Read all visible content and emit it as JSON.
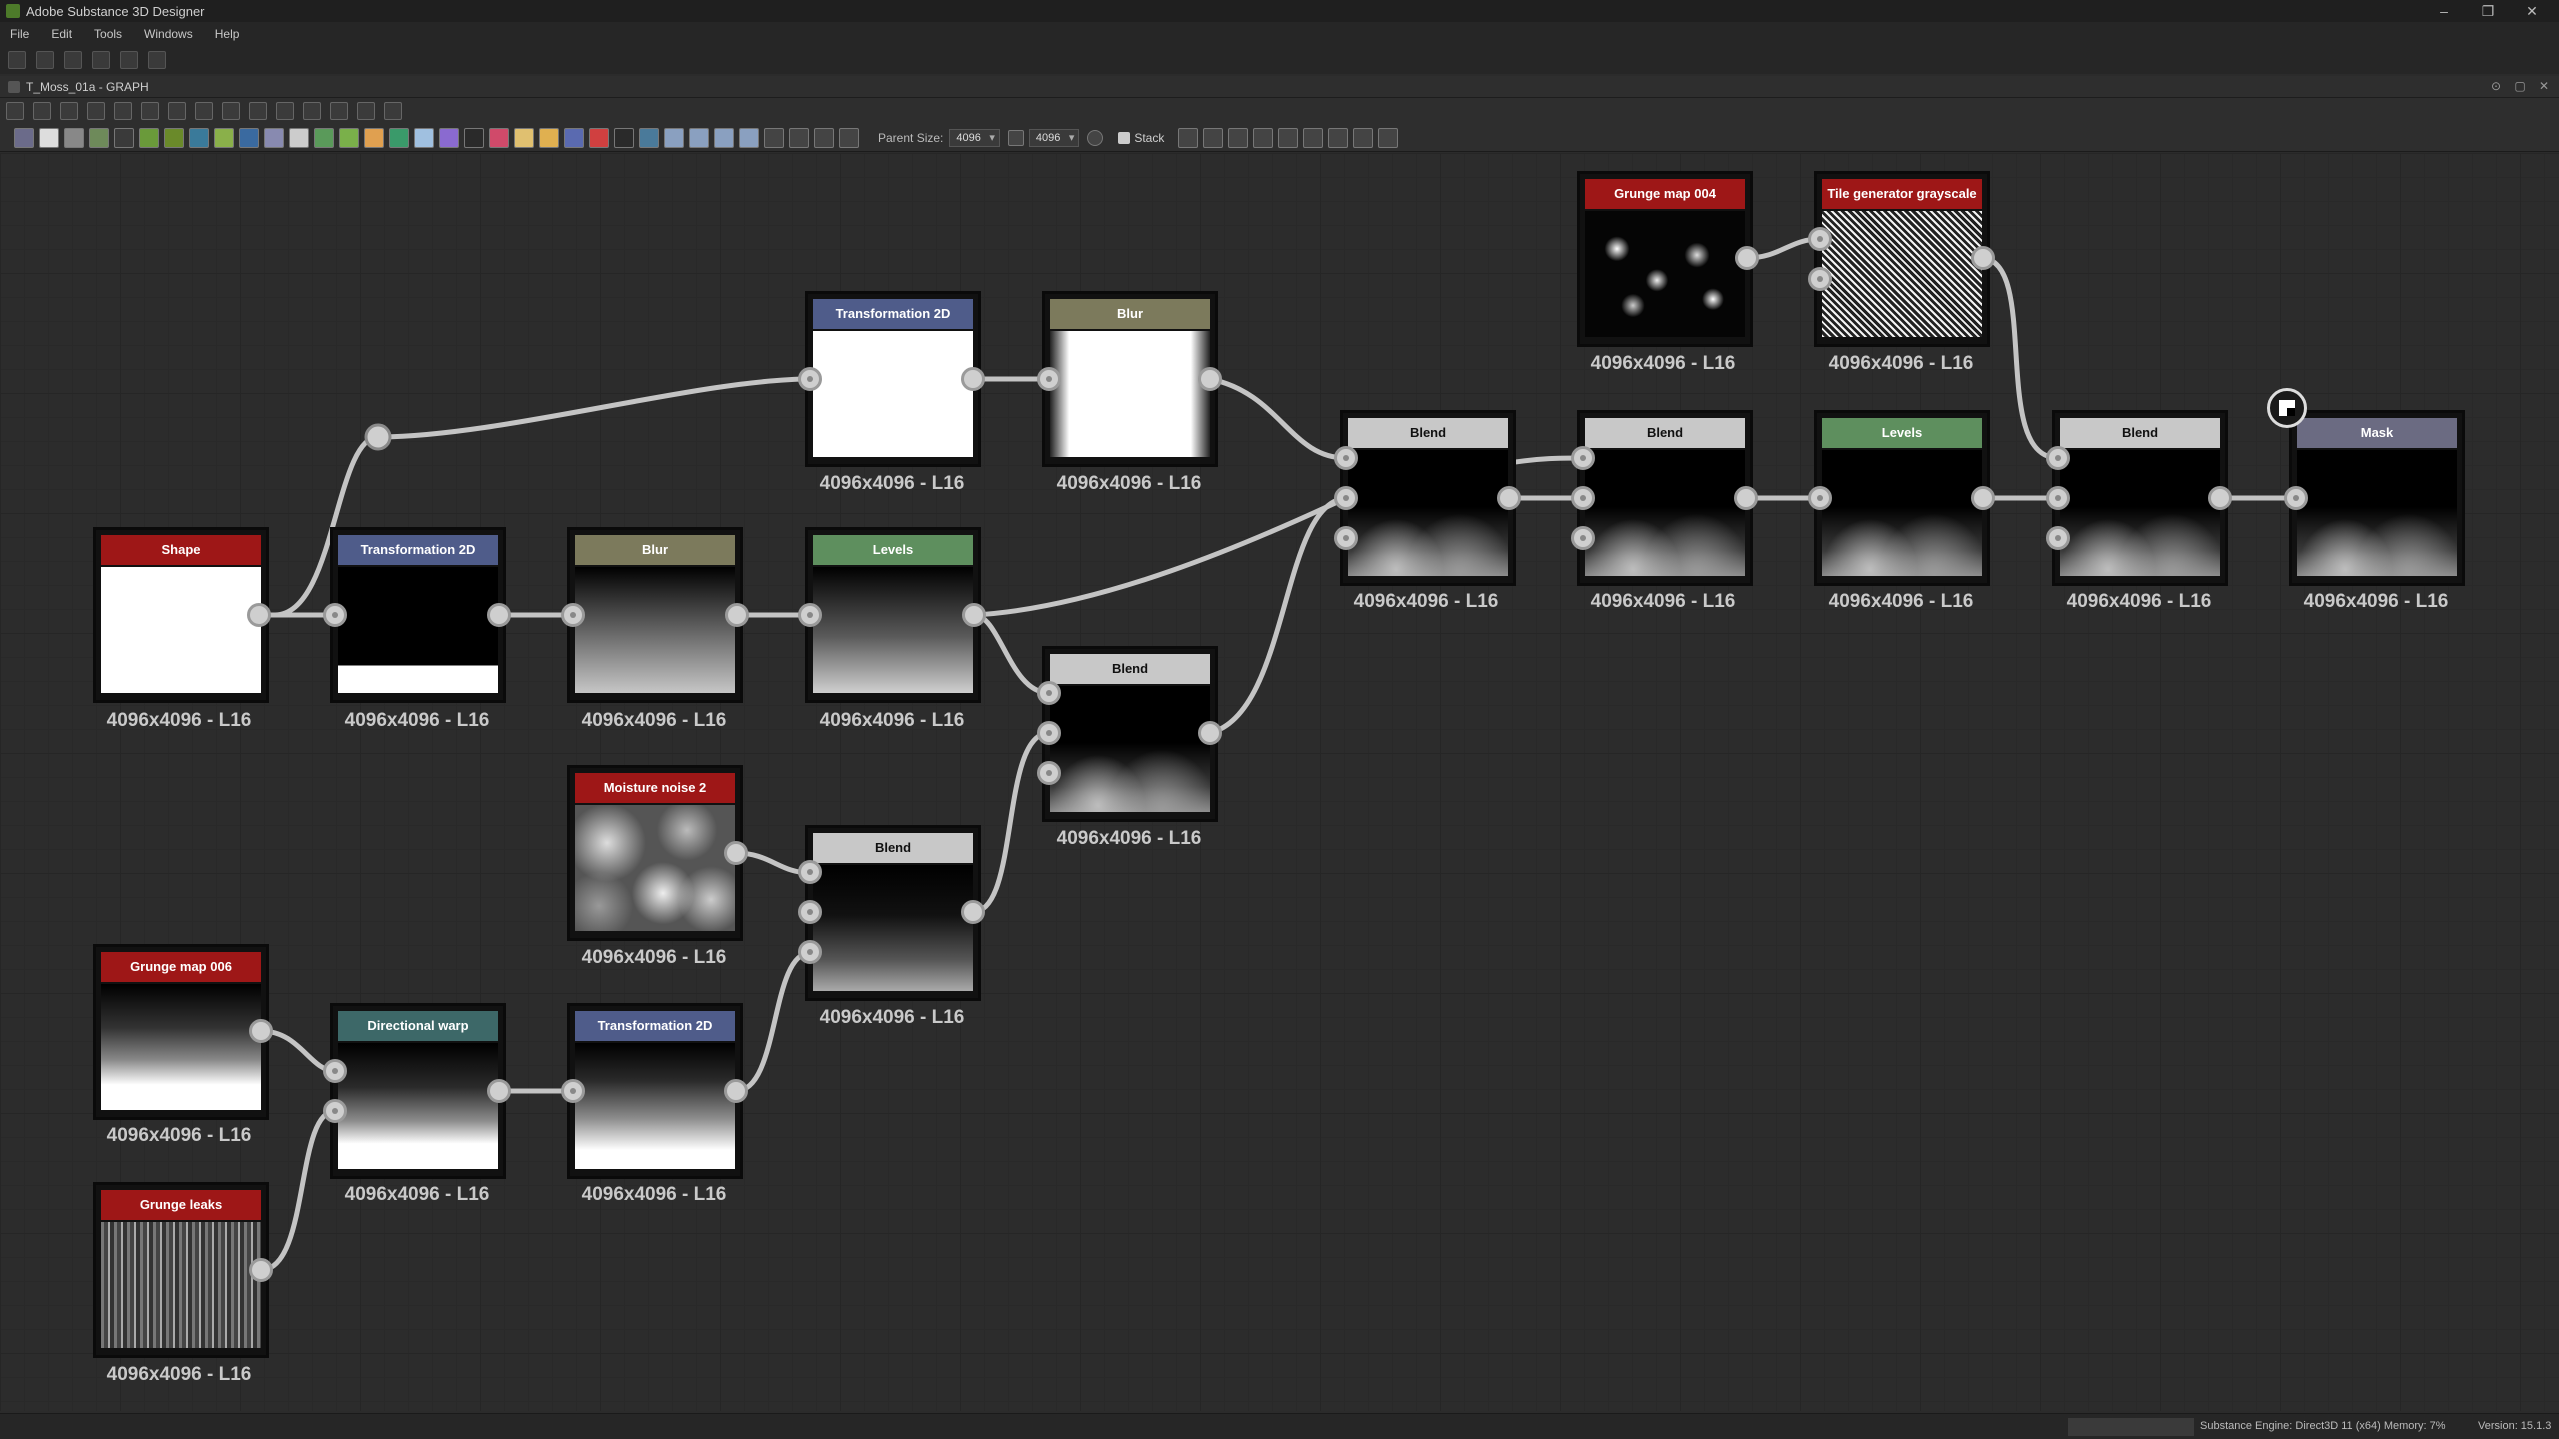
{
  "window": {
    "title": "Adobe Substance 3D Designer"
  },
  "menubar": {
    "items": [
      "File",
      "Edit",
      "Tools",
      "Windows",
      "Help"
    ]
  },
  "graph": {
    "tab_title": "T_Moss_01a - GRAPH",
    "parent_size_label": "Parent Size:",
    "parent_size_value": "4096",
    "output_size_value": "4096",
    "stack_label": "Stack"
  },
  "nodes": [
    {
      "id": "shape",
      "title": "Shape",
      "res": "4096x4096 - L16"
    },
    {
      "id": "t2d_a",
      "title": "Transformation 2D",
      "res": "4096x4096 - L16"
    },
    {
      "id": "blur_a",
      "title": "Blur",
      "res": "4096x4096 - L16"
    },
    {
      "id": "levels_a",
      "title": "Levels",
      "res": "4096x4096 - L16"
    },
    {
      "id": "t2d_top",
      "title": "Transformation 2D",
      "res": "4096x4096 - L16"
    },
    {
      "id": "blur_top",
      "title": "Blur",
      "res": "4096x4096 - L16"
    },
    {
      "id": "blend_mid",
      "title": "Blend",
      "res": "4096x4096 - L16"
    },
    {
      "id": "moisture",
      "title": "Moisture noise 2",
      "res": "4096x4096 - L16"
    },
    {
      "id": "blend_low",
      "title": "Blend",
      "res": "4096x4096 - L16"
    },
    {
      "id": "grunge006",
      "title": "Grunge map 006",
      "res": "4096x4096 - L16"
    },
    {
      "id": "dirwarp",
      "title": "Directional warp",
      "res": "4096x4096 - L16"
    },
    {
      "id": "t2d_low",
      "title": "Transformation 2D",
      "res": "4096x4096 - L16"
    },
    {
      "id": "leaks",
      "title": "Grunge leaks",
      "res": "4096x4096 - L16"
    },
    {
      "id": "grunge004",
      "title": "Grunge map 004",
      "res": "4096x4096 - L16"
    },
    {
      "id": "tilegen",
      "title": "Tile generator grayscale",
      "res": "4096x4096 - L16"
    },
    {
      "id": "blend_1",
      "title": "Blend",
      "res": "4096x4096 - L16"
    },
    {
      "id": "blend_2",
      "title": "Blend",
      "res": "4096x4096 - L16"
    },
    {
      "id": "levels_b",
      "title": "Levels",
      "res": "4096x4096 - L16"
    },
    {
      "id": "blend_3",
      "title": "Blend",
      "res": "4096x4096 - L16"
    },
    {
      "id": "mask",
      "title": "Mask",
      "res": "4096x4096 - L16"
    }
  ],
  "status": {
    "engine": "Substance Engine: Direct3D 11 (x64)   Memory: 7%",
    "version": "Version: 15.1.3"
  }
}
